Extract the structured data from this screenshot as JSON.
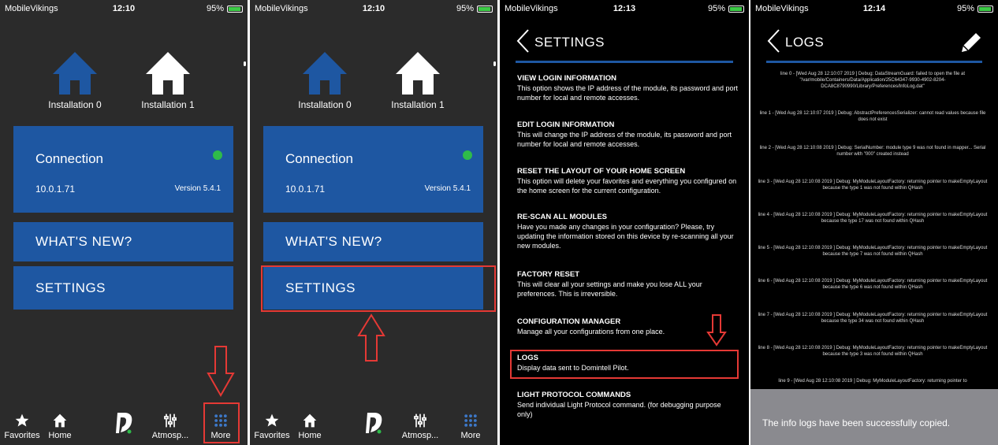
{
  "colors": {
    "blue": "#1e57a2",
    "green": "#2fbb4a",
    "red": "#e53935",
    "dark": "#2b2b2b"
  },
  "status_bars": [
    {
      "carrier": "MobileVikings",
      "time": "12:10",
      "battery": "95%"
    },
    {
      "carrier": "MobileVikings",
      "time": "12:10",
      "battery": "95%"
    },
    {
      "carrier": "MobileVikings",
      "time": "12:13",
      "battery": "95%"
    },
    {
      "carrier": "MobileVikings",
      "time": "12:14",
      "battery": "95%"
    }
  ],
  "home": {
    "installations": [
      "Installation 0",
      "Installation 1"
    ],
    "connection": {
      "title": "Connection",
      "ip": "10.0.1.71",
      "version": "Version 5.4.1"
    },
    "whats_new": "WHAT'S NEW?",
    "settings": "SETTINGS",
    "tabs": [
      "Favorites",
      "Home",
      "",
      "Atmosp...",
      "More"
    ]
  },
  "settings": {
    "title": "SETTINGS",
    "items": [
      {
        "title": "VIEW LOGIN INFORMATION",
        "desc": "This option shows the IP address of the module, its password and port number for local and remote accesses."
      },
      {
        "title": "EDIT LOGIN INFORMATION",
        "desc": "This will change the IP address of the module, its password and port number for local and remote accesses."
      },
      {
        "title": "RESET THE LAYOUT OF YOUR HOME SCREEN",
        "desc": "This option will delete your favorites and everything you configured on the home screen for the current configuration."
      },
      {
        "title": "RE-SCAN ALL MODULES",
        "desc": "Have you made any changes in your configuration? Please, try updating the information stored on this device by re-scanning all your new modules."
      },
      {
        "title": "FACTORY RESET",
        "desc": "This will clear all your settings and make you lose ALL your preferences. This is irreversible."
      },
      {
        "title": "CONFIGURATION MANAGER",
        "desc": "Manage all your configurations from one place."
      },
      {
        "title": "LOGS",
        "desc": "Display data sent to Domintell Pilot."
      },
      {
        "title": "LIGHT PROTOCOL COMMANDS",
        "desc": "Send individual Light Protocol command. (for debugging purpose only)"
      }
    ]
  },
  "logs": {
    "title": "LOGS",
    "entries": [
      "line 0 - [Wed Aug 28 12:10:07 2019        ] Debug: DataStreamGuard: failed to open the file at \"/var/mobile/Containers/Data/Application/25C64347-9930-4902-8204-DCA8C8790990/Library/Preferences/InfoLog.dat\"",
      "line 1 - [Wed Aug 28 12:10:07 2019        ] Debug: AbstractPreferencesSerializer: cannot read values because file does not exist",
      "line 2 - [Wed Aug 28 12:10:08 2019        ] Debug: SerialNumber: module type 9 was not found in mapper... Serial number with \"000\" created instead",
      "line 3 - [Wed Aug 28 12:10:08 2019        ] Debug: MyModuleLayoutFactory: returning pointer to makeEmptyLayout because the type 1 was not found within QHash",
      "line 4 - [Wed Aug 28 12:10:08 2019        ] Debug: MyModuleLayoutFactory: returning pointer to makeEmptyLayout because the type 17 was not found within QHash",
      "line 5 - [Wed Aug 28 12:10:08 2019        ] Debug: MyModuleLayoutFactory: returning pointer to makeEmptyLayout because the type 7 was not found within QHash",
      "line 6 - [Wed Aug 28 12:10:08 2019        ] Debug: MyModuleLayoutFactory: returning pointer to makeEmptyLayout because the type 6 was not found within QHash",
      "line 7 - [Wed Aug 28 12:10:08 2019        ] Debug: MyModuleLayoutFactory: returning pointer to makeEmptyLayout because the type 34 was not found within QHash",
      "line 8 - [Wed Aug 28 12:10:08 2019        ] Debug: MyModuleLayoutFactory: returning pointer to makeEmptyLayout because the type 3 was not found within QHash",
      "line 9 - [Wed Aug 28 12:10:08 2019        ] Debug: MyModuleLayoutFactory: returning pointer to"
    ],
    "toast": "The info logs have been successfully copied."
  }
}
